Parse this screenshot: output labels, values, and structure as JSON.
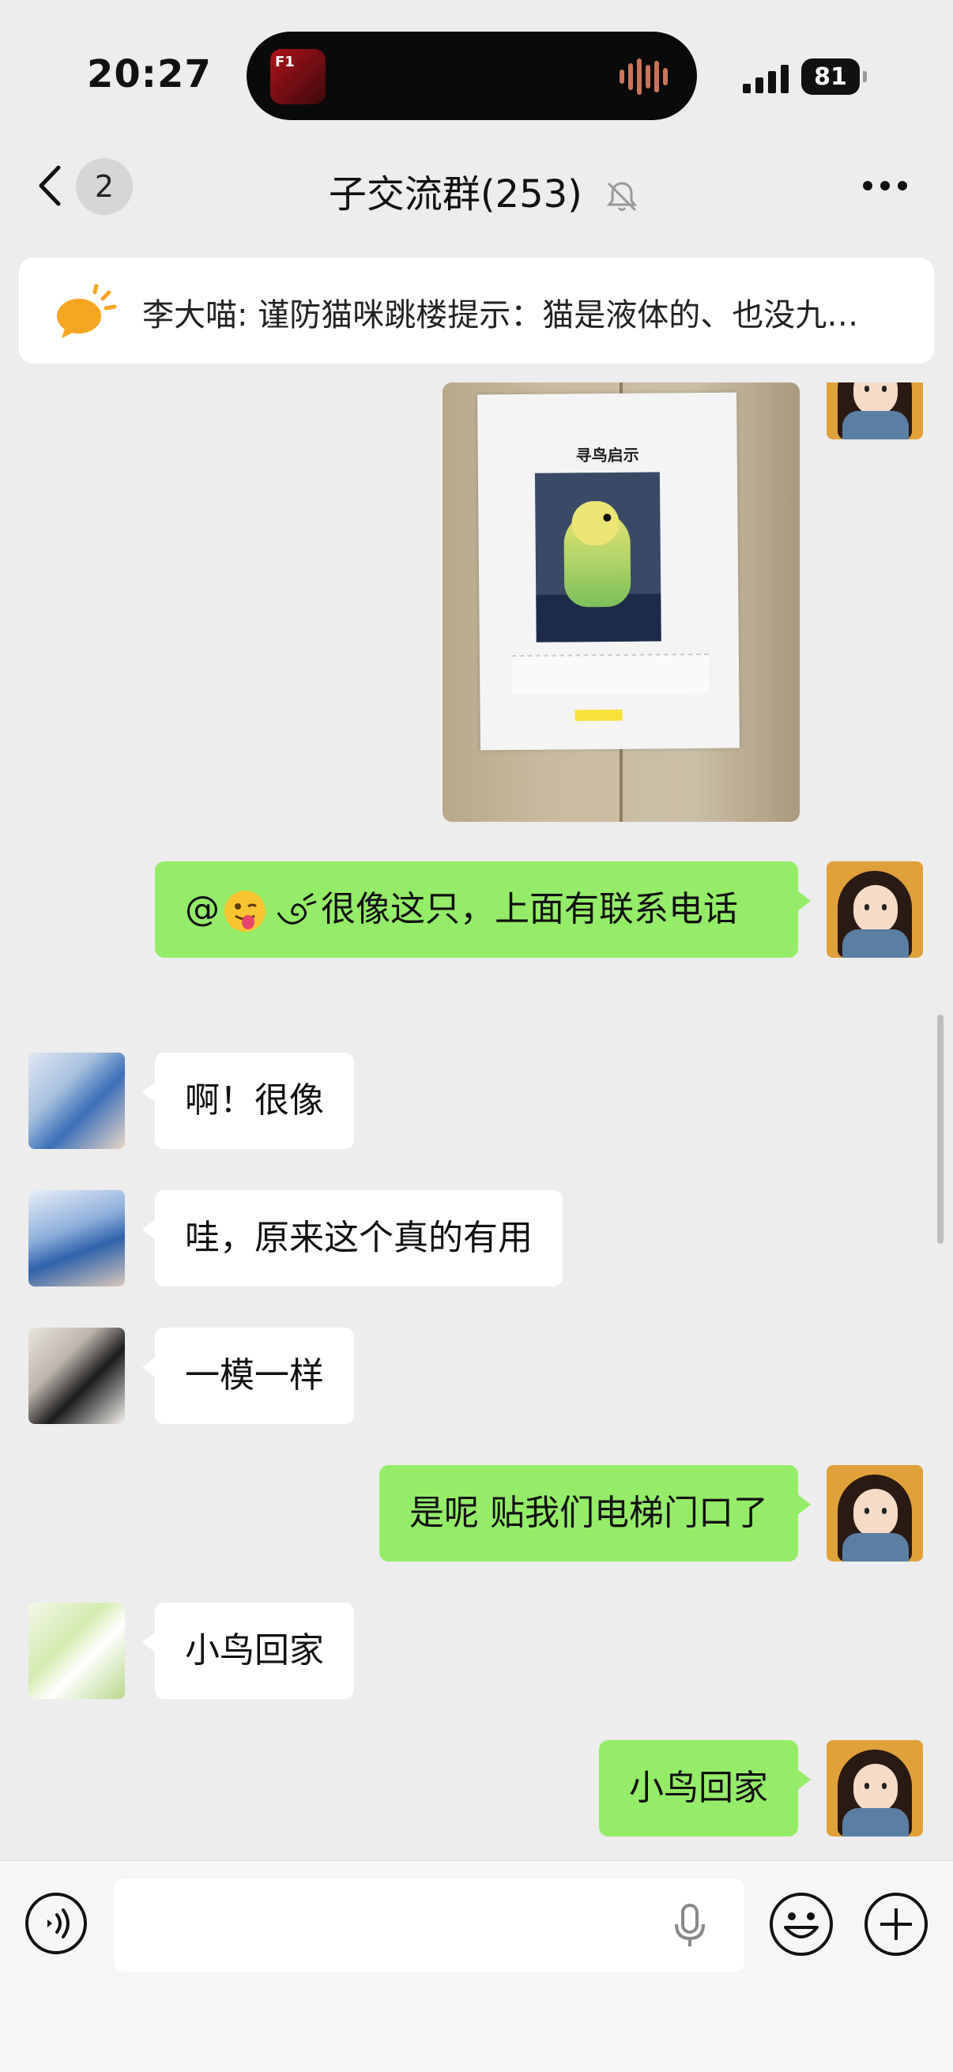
{
  "status_bar": {
    "time": "20:27",
    "battery": "81",
    "island_app_label": "F1"
  },
  "header": {
    "unread_count": "2",
    "title": "子交流群(253)",
    "muted": true,
    "icons": [
      "chevron-left-icon",
      "bell-slash-icon",
      "more-icon"
    ]
  },
  "pinned_notice": {
    "text": "李大喵: 谨防猫咪跳楼提示：猫是液体的、也没九…",
    "icon": "megaphone-icon",
    "accent_color": "#f5a623"
  },
  "messages": {
    "photo": {
      "poster_title": "寻鸟启示"
    },
    "m1": {
      "text_before": "@",
      "text_after": "很像这只，上面有联系电话"
    },
    "m2": {
      "text": "啊！很像"
    },
    "m3": {
      "text": "哇，原来这个真的有用"
    },
    "m4": {
      "text": "一模一样"
    },
    "m5": {
      "text": "是呢 贴我们电梯门口了"
    },
    "m6": {
      "text": "小鸟回家"
    },
    "m7": {
      "text": "小鸟回家"
    }
  },
  "colors": {
    "self_bubble": "#95ec69",
    "other_bubble": "#ffffff",
    "background": "#ededed"
  },
  "input_bar": {
    "placeholder": "",
    "icons": [
      "voice-icon",
      "mic-icon",
      "emoji-icon",
      "plus-icon"
    ]
  }
}
